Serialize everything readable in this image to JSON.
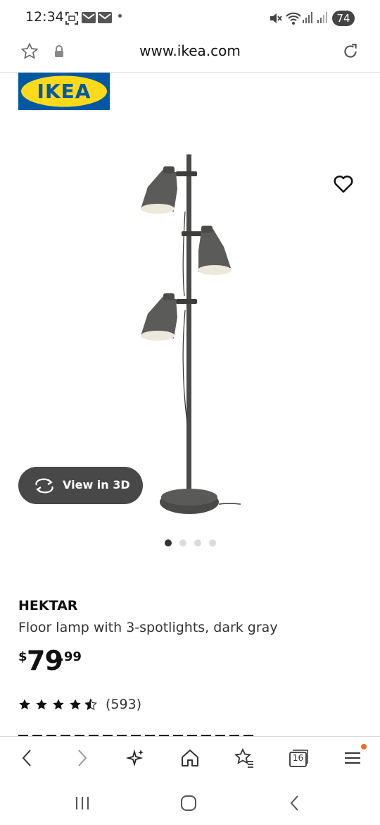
{
  "status_bar": {
    "time": "12:34",
    "battery": "74"
  },
  "url_bar": {
    "url": "www.ikea.com"
  },
  "brand": {
    "logo_text": "IKEA",
    "colors": {
      "blue": "#0058a3",
      "yellow": "#ffda1a"
    }
  },
  "product": {
    "name": "HEKTAR",
    "description": "Floor lamp with 3-spotlights, dark gray",
    "price": {
      "currency": "$",
      "whole": "79",
      "cents": ".99"
    },
    "rating": 4.5,
    "review_count": "(593)",
    "view_3d_label": "View in 3D",
    "image_count": 4,
    "active_image": 1
  },
  "toolbar": {
    "tab_count": "16",
    "icons": [
      "back-icon",
      "forward-icon",
      "sparkle-icon",
      "home-icon",
      "bookmarks-icon",
      "tabs-icon",
      "menu-icon"
    ]
  },
  "accent_color": "#f26a1b"
}
